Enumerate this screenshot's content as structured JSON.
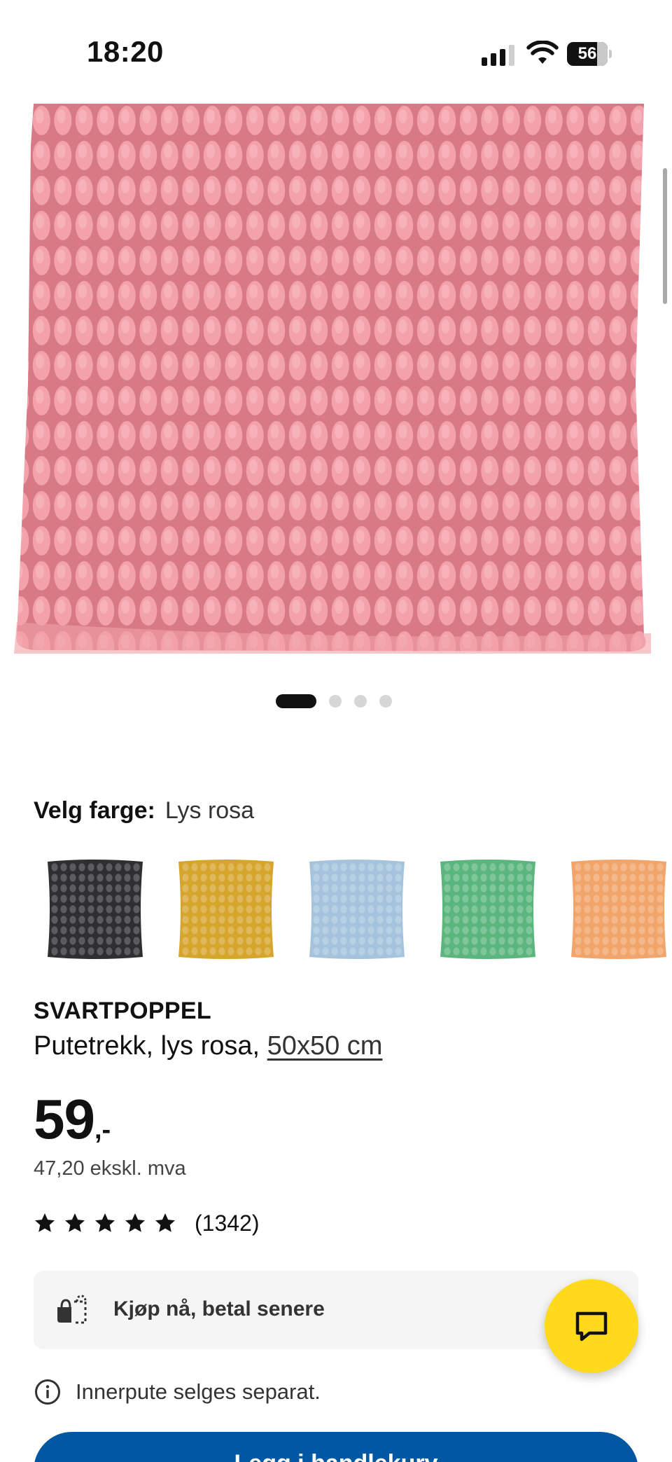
{
  "status_bar": {
    "time": "18:20",
    "battery_level": "56",
    "icons": [
      "cellular-signal-icon",
      "wifi-icon",
      "battery-icon"
    ]
  },
  "product_image": {
    "carousel_total": 4,
    "carousel_active": 1,
    "color": "#e58c95"
  },
  "color_selector": {
    "label": "Velg farge:",
    "selected": "Lys rosa",
    "swatches": [
      {
        "name": "black",
        "color": "#2f2f31"
      },
      {
        "name": "yellow",
        "color": "#d5a52c"
      },
      {
        "name": "light-blue",
        "color": "#a5c3dd"
      },
      {
        "name": "green",
        "color": "#5bb67e"
      },
      {
        "name": "orange",
        "color": "#f1a56a"
      }
    ]
  },
  "product": {
    "name": "SVARTPOPPEL",
    "description": "Putetrekk, lys rosa, ",
    "size": "50x50 cm",
    "price_integer": "59",
    "price_suffix": ",-",
    "price_ex_vat": "47,20 ekskl. mva",
    "rating_stars": 5,
    "rating_count": "(1342)"
  },
  "pay_later": {
    "label": "Kjøp nå, betal senere"
  },
  "note": {
    "text": "Innerpute selges separat."
  },
  "cta": {
    "label": "Legg i handlekurv"
  },
  "colors": {
    "brand_blue": "#0058a3",
    "chat_yellow": "#ffd91b",
    "card_gray": "#f5f5f5"
  }
}
